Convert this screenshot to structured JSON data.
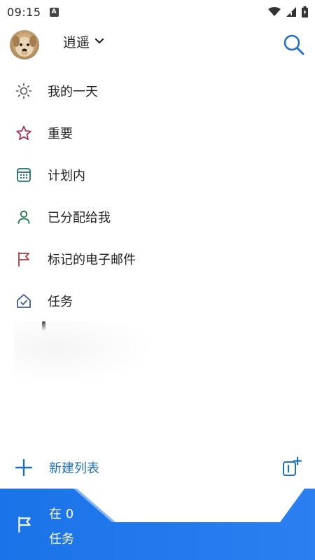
{
  "status_bar": {
    "time": "09:15",
    "notification_icon": "a-icon",
    "icons": [
      "wifi-icon",
      "signal-icon",
      "battery-icon"
    ]
  },
  "header": {
    "account_name": "逍遥",
    "avatar": "avatar",
    "search_icon": "search-icon"
  },
  "nav": {
    "items": [
      {
        "label": "我的一天",
        "icon": "sun-icon",
        "color": "#555555"
      },
      {
        "label": "重要",
        "icon": "star-icon",
        "color": "#a1335e"
      },
      {
        "label": "计划内",
        "icon": "calendar-icon",
        "color": "#1f6e6e"
      },
      {
        "label": "已分配给我",
        "icon": "person-icon",
        "color": "#1f7a4a"
      },
      {
        "label": "标记的电子邮件",
        "icon": "flag-icon",
        "color": "#b33a3a"
      },
      {
        "label": "任务",
        "icon": "home-icon",
        "color": "#3d5a99"
      }
    ]
  },
  "new_list": {
    "label": "新建列表",
    "plus_icon": "plus-icon",
    "group_icon": "new-group-icon",
    "accent": "#1d6fc4"
  },
  "banner": {
    "line1": "在 0",
    "line2": "任务",
    "flag_icon": "flag-icon",
    "color": "#1a73e8"
  }
}
